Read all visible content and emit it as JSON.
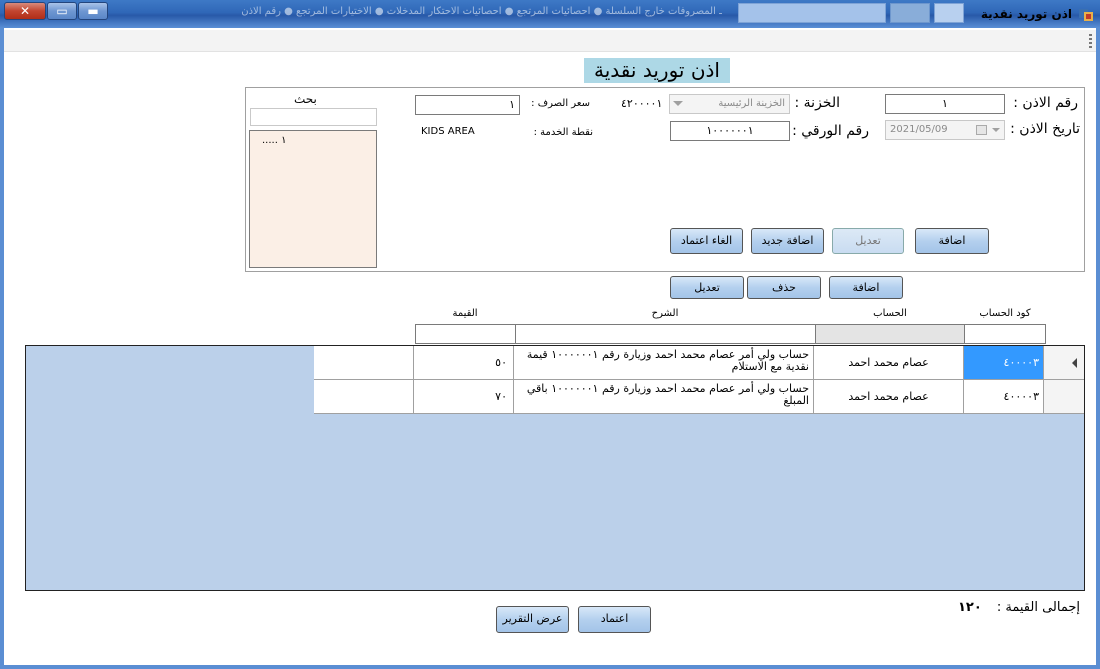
{
  "window": {
    "title": "اذن توريد نقدية",
    "faded_tabs": "ـ المصروفات خارج السلسلة  ●  احصائيات المرتجع  ●  احصائيات الاحتكار المدخلات  ●  الاختيارات المرتجع  ●  رقم الاذن"
  },
  "form": {
    "title": "اذن توريد نقدية",
    "search_label": "بحث",
    "search_value": "",
    "list_items": [
      "١ ....."
    ],
    "voucher_no_label": "رقم الاذن :",
    "voucher_no_value": "١",
    "voucher_date_label": "تاريخ الاذن :",
    "voucher_date_value": "2021/05/09",
    "treasury_label": "الخزنة :",
    "treasury_value": "الخزينة الرئيسية",
    "treasury_code": "٤٢٠٠٠٠١",
    "paper_no_label": "رقم الورقي :",
    "paper_no_value": "١٠٠٠٠٠٠١",
    "exchange_rate_label": "سعر الصرف :",
    "exchange_rate_value": "١",
    "service_point_label": "نقطة الخدمة :",
    "service_point_value": "KIDS AREA",
    "buttons": {
      "add": "اضافة",
      "edit": "تعديل",
      "add_new": "اضافة جديد",
      "cancel_approval": "الغاء اعتماد"
    }
  },
  "detail_buttons": {
    "add": "اضافة",
    "delete": "حذف",
    "edit": "تعديل"
  },
  "detail_headers": {
    "account_code": "كود الحساب",
    "account": "الحساب",
    "description": "الشرح",
    "value": "القيمة"
  },
  "grid": {
    "rows": [
      {
        "account_code": "٤٠٠٠٠٣",
        "account": "عصام محمد احمد",
        "description": "حساب ولي أمر عصام محمد احمد وزيارة رقم ١٠٠٠٠٠٠١ قيمة نقدية مع الاستلام",
        "value": "٥٠",
        "selected": true
      },
      {
        "account_code": "٤٠٠٠٠٣",
        "account": "عصام محمد احمد",
        "description": "حساب ولي أمر عصام محمد احمد وزيارة رقم ١٠٠٠٠٠٠١ باقي المبلغ",
        "value": "٧٠",
        "selected": false
      }
    ]
  },
  "footer": {
    "total_label": "إجمالى القيمة :",
    "total_value": "١٢٠",
    "approve": "اعتماد",
    "show_report": "عرض التقرير"
  },
  "colors": {
    "title_highlight": "#add8e6",
    "grid_background": "#bbd0ea",
    "selection": "#3399ff",
    "list_background": "#fbefe6"
  }
}
